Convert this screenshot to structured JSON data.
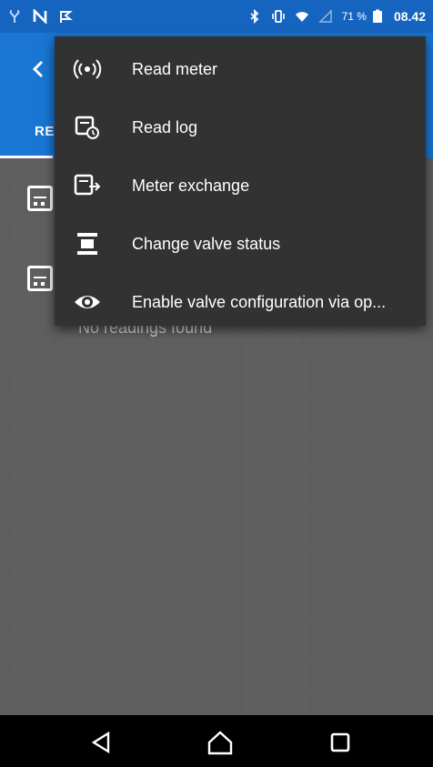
{
  "status_bar": {
    "battery_percent": "71 %",
    "time": "08.42"
  },
  "tabs": {
    "active_label": "RE"
  },
  "content": {
    "empty_text": "No readings found"
  },
  "menu": {
    "items": [
      {
        "label": "Read meter",
        "icon": "radio-waves-icon"
      },
      {
        "label": "Read log",
        "icon": "meter-clock-icon"
      },
      {
        "label": "Meter exchange",
        "icon": "meter-exchange-icon"
      },
      {
        "label": "Change valve status",
        "icon": "valve-icon"
      },
      {
        "label": "Enable valve configuration via op...",
        "icon": "eye-icon"
      }
    ]
  },
  "colors": {
    "primary": "#1976d2",
    "status_bar": "#1565c0",
    "menu_bg": "#323232",
    "content_bg": "#616161"
  }
}
